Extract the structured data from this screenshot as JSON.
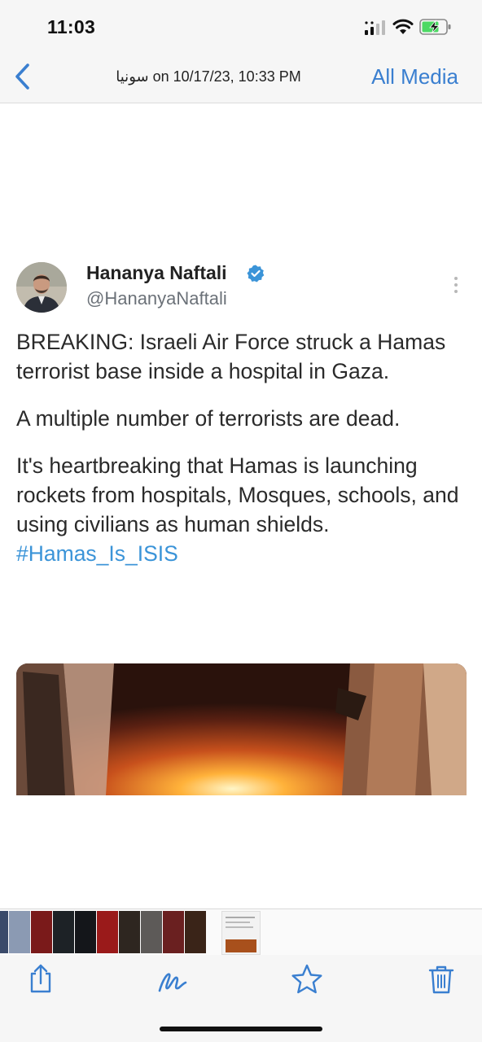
{
  "status_bar": {
    "time": "11:03",
    "battery_charging": true
  },
  "nav": {
    "back_icon": "chevron-left-icon",
    "title": "سونيا on 10/17/23, 10:33 PM",
    "all_media_label": "All Media",
    "accent_color": "#3a7fd0"
  },
  "tweet": {
    "display_name": "Hananya Naftali",
    "handle": "@HananyaNaftali",
    "verified": true,
    "paragraph_1": "BREAKING: Israeli Air Force struck a Hamas terrorist base inside a hospital in Gaza.",
    "paragraph_2": "A multiple number of terrorists are dead.",
    "paragraph_3_text": "It's heartbreaking that Hamas is launching rockets from hospitals, Mosques, schools, and using civilians as human shields. ",
    "hashtag": "#Hamas_Is_ISIS",
    "hashtag_color": "#3b94d8"
  },
  "thumbnails": {
    "colors": [
      "#3a4a6a",
      "#c9c4c0",
      "#8a2020",
      "#222222",
      "#101418",
      "#8a1010",
      "#2a2520",
      "#6a6a6a",
      "#5a1818",
      "#302018"
    ],
    "selected_index": 11
  },
  "toolbar": {
    "share_icon": "share-icon",
    "markup_icon": "markup-icon",
    "favorite_icon": "star-icon",
    "delete_icon": "trash-icon",
    "icon_color": "#3a7fd0"
  }
}
